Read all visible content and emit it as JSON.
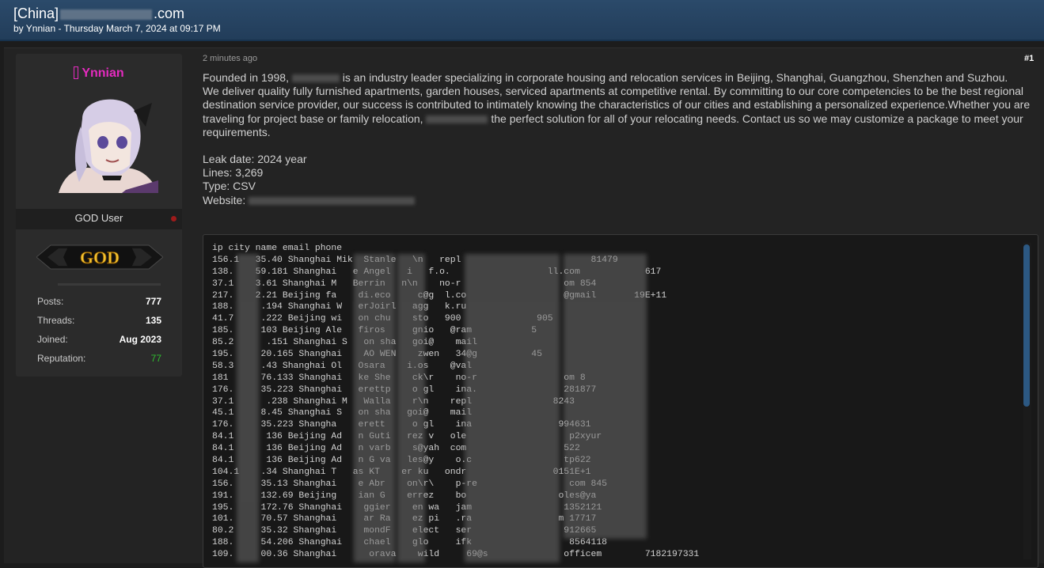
{
  "thread": {
    "title_prefix": "[China]",
    "title_suffix": ".com",
    "meta": "by Ynnian - Thursday March 7, 2024 at 09:17 PM"
  },
  "user": {
    "username": "Ynnian",
    "rank": "GOD User",
    "badge": "GOD",
    "stats": [
      {
        "label": "Posts:",
        "value": "777"
      },
      {
        "label": "Threads:",
        "value": "135"
      },
      {
        "label": "Joined:",
        "value": "Aug 2023"
      },
      {
        "label": "Reputation:",
        "value": "77"
      }
    ]
  },
  "post": {
    "time": "2 minutes ago",
    "number": "#1",
    "p1a": "Founded in 1998,",
    "p1b": "is an industry leader specializing in corporate housing and relocation services in Beijing, Shanghai, Guangzhou, Shenzhen and Suzhou.",
    "p2a": "We deliver quality fully furnished apartments, garden houses, serviced apartments at competitive rental. By committing to our core competencies to be the best regional destination service provider, our success is contributed to intimately knowing the characteristics of our cities and establishing a personalized experience.Whether you are traveling for project base or family relocation,",
    "p2b": "the perfect solution for all of your relocating needs. Contact us so we may customize a package to meet your requirements.",
    "leak_date": "Leak date: 2024 year",
    "lines": "Lines: 3,269",
    "type": "Type: CSV",
    "website": "Website:"
  },
  "code": {
    "lines": [
      "ip city name email phone",
      "156.1   35.40 Shanghai Mik  Stanle   \\n   repl                        81479",
      "138.    59.181 Shanghai   e Angel   i   f.o.                  ll.com            617",
      "37.1    3.61 Shanghai M   Berrin   n\\n    no-r                   om 854",
      "217.    2.21 Beijing fa    di.eco     c@g  l.co                  @gmail       19E+11",
      "188.     .194 Shanghai W   erJoirl   agg   k.ru",
      "41.7     .222 Beijing wi   on chu    sto   900              905",
      "185.     103 Beijing Ale   firos     gnio   @ram           5",
      "85.2      .151 Shanghai S   on sha   goi@    mail",
      "195.     20.165 Shanghai    AO WEN    zwen   34@g          45",
      "58.3     .43 Shanghai Ol   Osara    i.os    @val",
      "181      76.133 Shanghai   ke She    ck\\r    no-r                om 8",
      "176.     35.223 Shanghai   erettp    o gl    ina.                281877",
      "37.1      .238 Shanghai M   Walla    r\\n    repl               8243",
      "45.1     8.45 Shanghai S   on sha   goi@    mail",
      "176.     35.223 Shangha    erett     o gl    ina                994631",
      "84.1      136 Beijing Ad   n Guti   rez v   ole                   p2xyur",
      "84.1      136 Beijing Ad   n varb    s@yah  com                  522",
      "84.1      136 Beijing Ad   n G va   les@y    o.c                 tp622",
      "104.1    .34 Shanghai T   as KT    er ku   ondr                0151E+1",
      "156.     35.13 Shanghai    e Abr    on\\r\\    p-re                 com 845",
      "191.     132.69 Beijing    ian G    errez    bo                 oles@ya",
      "195.     172.76 Shanghai    ggier    en wa   jam                 1352121",
      "101.     70.57 Shanghai     ar Ra    ez pi   .ra                m 17717",
      "80.2     35.32 Shanghai     mondF    elect   ser                 912665",
      "188.     54.206 Shanghai    chael    glo     ifk                  8564118",
      "109.     00.36 Shanghai      orava    wild     69@s              officem        7182197331"
    ]
  }
}
